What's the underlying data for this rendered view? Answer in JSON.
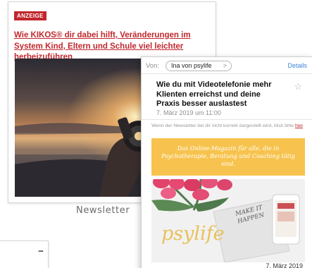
{
  "newsletter_card": {
    "badge": "ANZEIGE",
    "headline": "Wie KIKOS® dir dabei hilft, Veränderungen im System Kind, Eltern und Schule viel leichter herbeizuführen"
  },
  "caption": "Newsletter",
  "mini_card": {
    "more_label": "..."
  },
  "email": {
    "from_label": "Von:",
    "sender": "Ina von psylife",
    "details_label": "Details",
    "subject": "Wie du mit Videotelefonie mehr Klienten erreichst und deine Praxis besser auslastest",
    "date": "7. März 2019 um 11:00",
    "notice_text": "Wenn der Newsletter bei dir nicht korrekt dargestellt wird, klick bitte",
    "notice_link": "hier",
    "notice_end": ".",
    "banner_text": "Das Online-Magazin für alle, die in Psychotherapie, Beratung und Coaching tätig sind.",
    "brand": "psylife",
    "notebook_text": "MAKE IT HAPPEN",
    "hero_date": "7. März 2019"
  },
  "colors": {
    "accent": "#c1272d",
    "banner": "#f7c34e",
    "link": "#3d86d6",
    "brand": "#e8c15a"
  }
}
